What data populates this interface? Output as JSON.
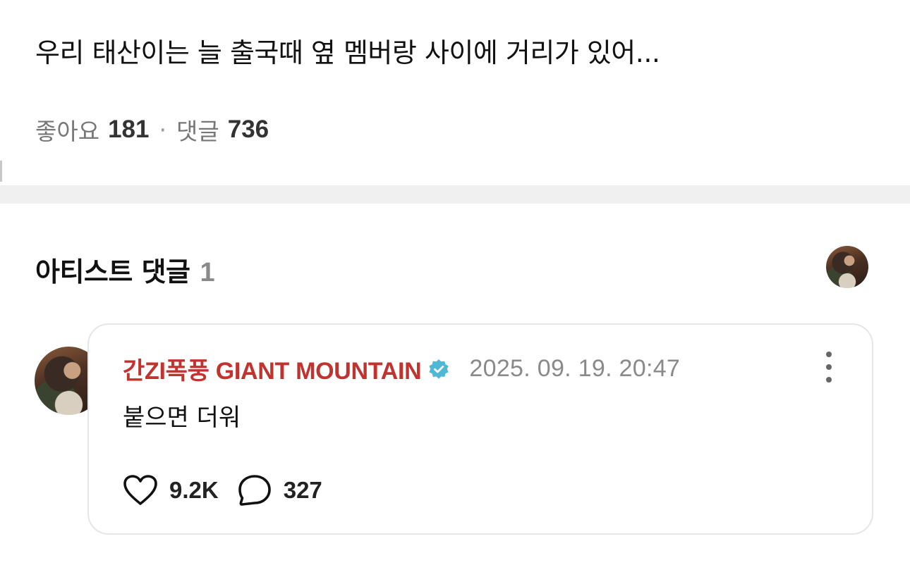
{
  "post": {
    "title": "우리 태산이는 늘 출국때 옆 멤버랑 사이에 거리가 있어...",
    "likes_label": "좋아요",
    "likes_count": "181",
    "separator": "·",
    "comments_label": "댓글",
    "comments_count": "736"
  },
  "artist_comments": {
    "title": "아티스트 댓글",
    "count": "1",
    "avatar_icon": "artist-avatar"
  },
  "comment": {
    "author": "간ZI폭풍 GIANT MOUNTAIN",
    "author_color": "#c0332f",
    "verified_icon": "verified-badge-icon",
    "verified_color": "#4fb8d6",
    "timestamp": "2025. 09. 19. 20:47",
    "text": "붙으면 더워",
    "likes": "9.2K",
    "replies": "327",
    "like_icon": "heart-outline-icon",
    "reply_icon": "speech-bubble-icon",
    "more_icon": "vertical-ellipsis-icon"
  }
}
